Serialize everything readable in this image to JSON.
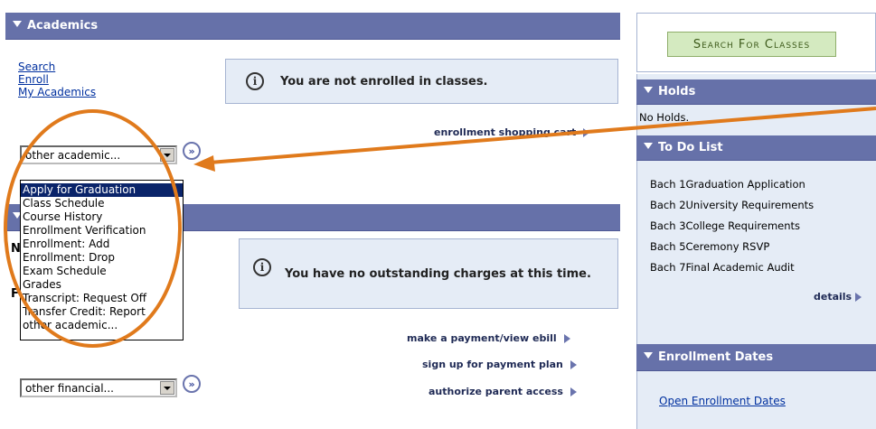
{
  "academics": {
    "header": "Academics",
    "links": [
      "Search",
      "Enroll",
      "My Academics"
    ],
    "not_enrolled_msg": "You are not enrolled in classes.",
    "shopping_cart_link": "enrollment shopping cart",
    "select_value": "other academic...",
    "dropdown_options": [
      "Apply for Graduation",
      "Class Schedule",
      "Course History",
      "Enrollment Verification",
      "Enrollment: Add",
      "Enrollment: Drop",
      "Exam Schedule",
      "Grades",
      "Transcript: Request Off",
      "Transfer Credit: Report",
      "other academic..."
    ],
    "selected_option_index": 0
  },
  "finances": {
    "partial_letters": [
      "N",
      "F"
    ],
    "no_charges_msg": "You have no outstanding charges at this time.",
    "action_links": [
      "make a payment/view ebill",
      "sign up for payment plan",
      "authorize parent access"
    ],
    "select_value": "other financial..."
  },
  "sidebar": {
    "search_button": "Search For Classes",
    "holds": {
      "header": "Holds",
      "text": "No Holds."
    },
    "todo": {
      "header": "To Do List",
      "items": [
        "Bach 1Graduation Application",
        "Bach 2University Requirements",
        "Bach 3College Requirements",
        "Bach 5Ceremony RSVP",
        "Bach 7Final Academic Audit"
      ],
      "details_link": "details"
    },
    "enrollment_dates": {
      "header": "Enrollment Dates",
      "link": "Open Enrollment Dates"
    }
  },
  "colors": {
    "header_bg": "#6671a9",
    "panel_bg": "#e5ecf6",
    "link": "#00309f",
    "annotation": "#e07a1c",
    "search_btn_bg": "#d4eac0"
  }
}
